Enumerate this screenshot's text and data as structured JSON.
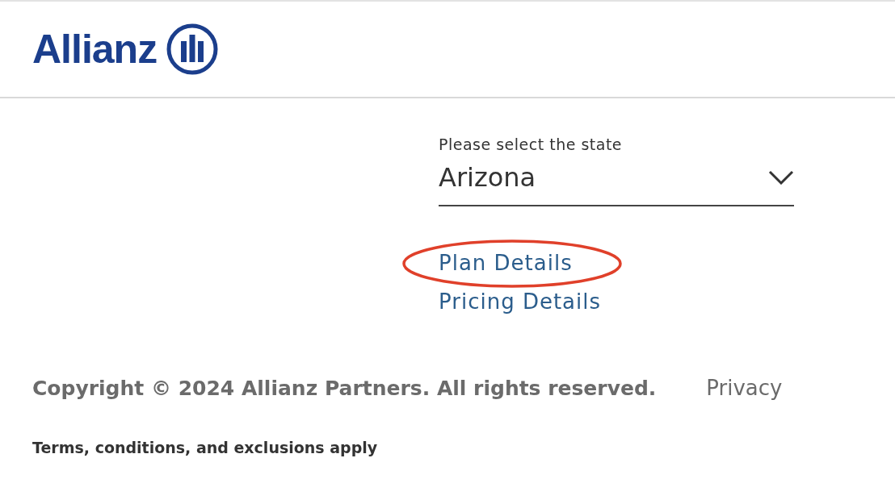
{
  "header": {
    "logo_text": "Allianz"
  },
  "state_select": {
    "label": "Please select the state",
    "value": "Arizona"
  },
  "links": [
    {
      "label": "Plan Details",
      "highlighted": true
    },
    {
      "label": "Pricing Details",
      "highlighted": false
    }
  ],
  "footer": {
    "copyright": "Copyright © 2024 Allianz Partners. All rights reserved.",
    "privacy": "Privacy",
    "terms": "Terms, conditions, and exclusions apply"
  }
}
